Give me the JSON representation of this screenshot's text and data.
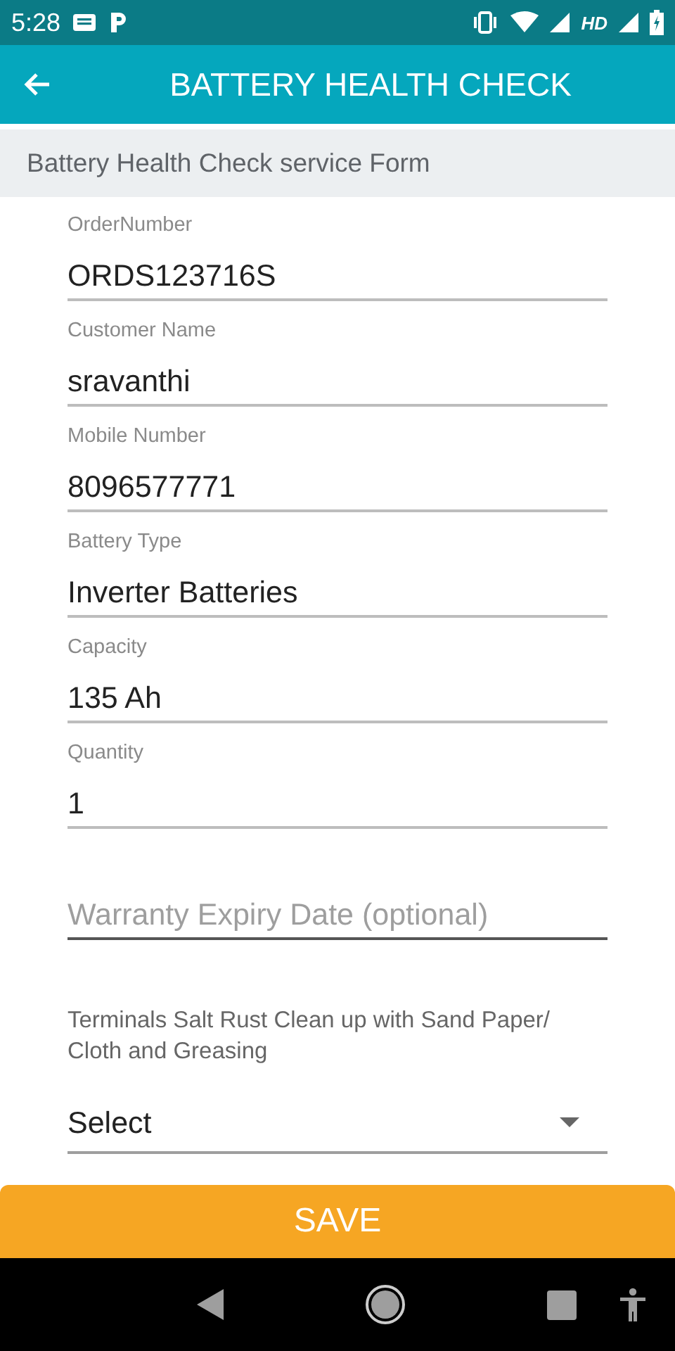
{
  "status_bar": {
    "time": "5:28",
    "network_label": "HD"
  },
  "app_bar": {
    "title": "BATTERY HEALTH CHECK"
  },
  "section_header": "Battery Health Check service Form",
  "fields": [
    {
      "kind": "filled",
      "label": "OrderNumber",
      "value": "ORDS123716S"
    },
    {
      "kind": "filled",
      "label": "Customer Name",
      "value": "sravanthi"
    },
    {
      "kind": "filled",
      "label": "Mobile Number",
      "value": "8096577771"
    },
    {
      "kind": "filled",
      "label": "Battery Type",
      "value": "Inverter Batteries"
    },
    {
      "kind": "filled",
      "label": "Capacity",
      "value": "135 Ah"
    },
    {
      "kind": "filled",
      "label": "Quantity",
      "value": "1"
    },
    {
      "kind": "empty",
      "placeholder": "Warranty Expiry Date (optional)"
    },
    {
      "kind": "select",
      "label": "Terminals Salt Rust Clean up with Sand Paper/ Cloth and Greasing",
      "value": "Select"
    }
  ],
  "save_button": "SAVE"
}
